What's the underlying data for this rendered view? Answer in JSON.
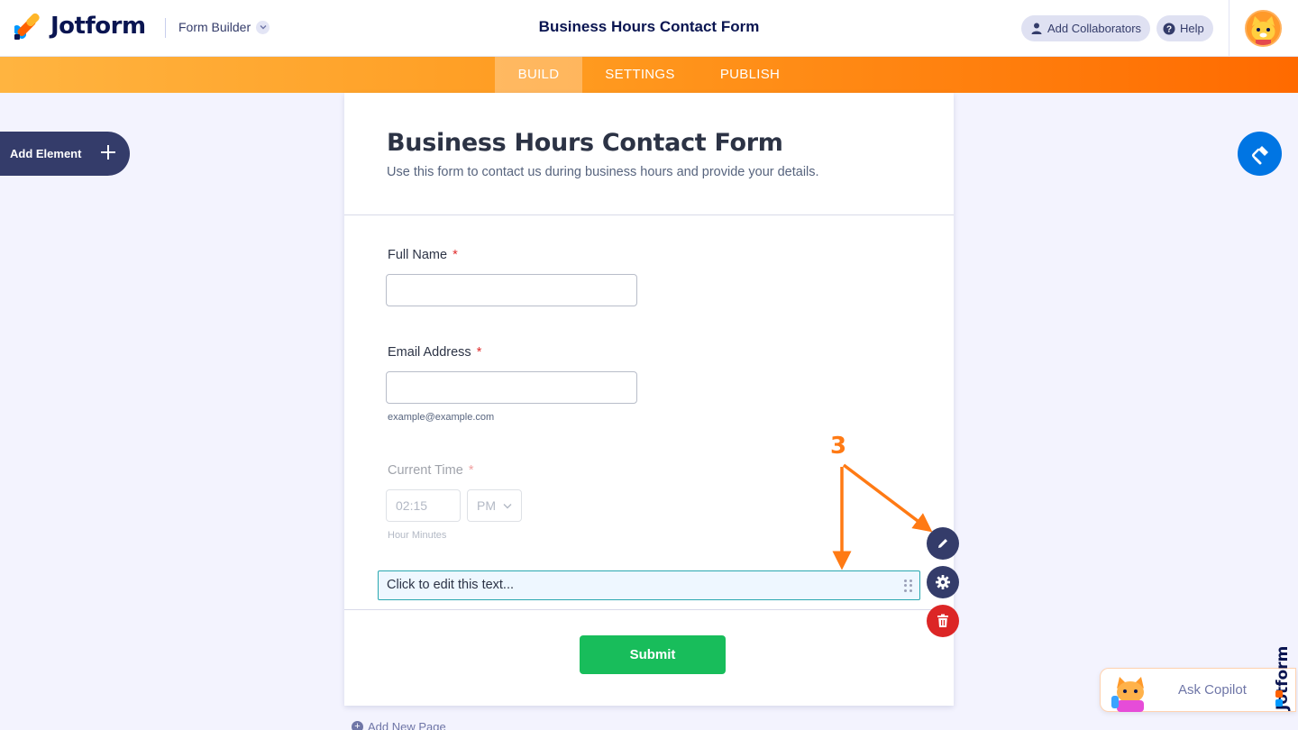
{
  "header": {
    "logo_text": "Jotform",
    "builder_menu_label": "Form Builder",
    "form_title": "Business Hours Contact Form",
    "add_collaborators_label": "Add Collaborators",
    "help_label": "Help"
  },
  "tabs": [
    {
      "label": "BUILD",
      "active": true
    },
    {
      "label": "SETTINGS",
      "active": false
    },
    {
      "label": "PUBLISH",
      "active": false
    }
  ],
  "sidebar": {
    "add_element_label": "Add Element"
  },
  "form": {
    "title": "Business Hours Contact Form",
    "subtitle": "Use this form to contact us during business hours and provide your details.",
    "fields": {
      "full_name": {
        "label": "Full Name",
        "required_mark": "*",
        "value": ""
      },
      "email": {
        "label": "Email Address",
        "required_mark": "*",
        "value": "",
        "sublabel": "example@example.com"
      },
      "current_time": {
        "label": "Current Time",
        "required_mark": "*",
        "time_value": "02:15",
        "ampm_value": "PM",
        "sublabel": "Hour Minutes"
      }
    },
    "text_element": "Click to edit this text...",
    "submit_label": "Submit"
  },
  "annotation": {
    "step_number": "3"
  },
  "add_page_label": "Add New Page",
  "copilot": {
    "label": "Ask Copilot"
  },
  "colors": {
    "brand_navy": "#0a1551",
    "nav_orange": "#ff9a1f",
    "submit_green": "#18bd5b",
    "delete_red": "#dc2626",
    "annotation_orange": "#ff7a14",
    "paint_blue": "#0075e3"
  }
}
